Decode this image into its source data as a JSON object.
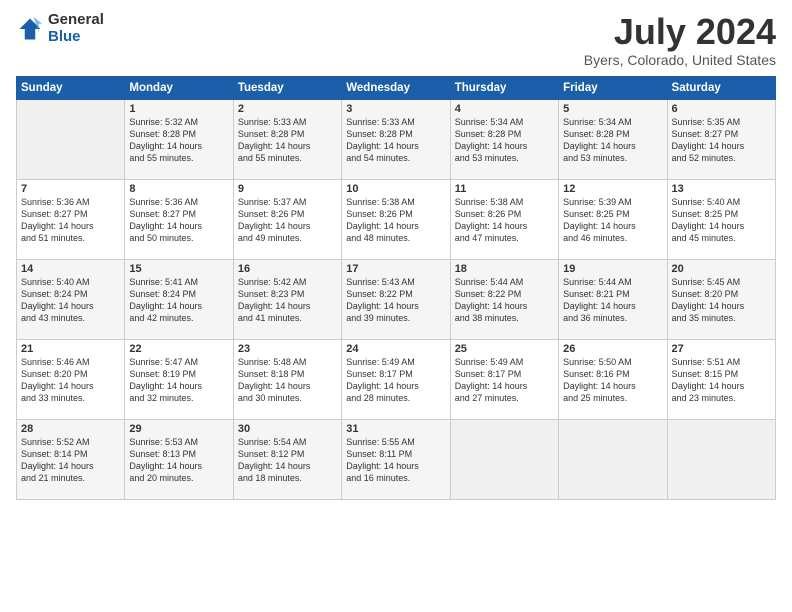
{
  "header": {
    "logo_general": "General",
    "logo_blue": "Blue",
    "month_year": "July 2024",
    "location": "Byers, Colorado, United States"
  },
  "columns": [
    "Sunday",
    "Monday",
    "Tuesday",
    "Wednesday",
    "Thursday",
    "Friday",
    "Saturday"
  ],
  "rows": [
    [
      {
        "day": "",
        "info": ""
      },
      {
        "day": "1",
        "info": "Sunrise: 5:32 AM\nSunset: 8:28 PM\nDaylight: 14 hours\nand 55 minutes."
      },
      {
        "day": "2",
        "info": "Sunrise: 5:33 AM\nSunset: 8:28 PM\nDaylight: 14 hours\nand 55 minutes."
      },
      {
        "day": "3",
        "info": "Sunrise: 5:33 AM\nSunset: 8:28 PM\nDaylight: 14 hours\nand 54 minutes."
      },
      {
        "day": "4",
        "info": "Sunrise: 5:34 AM\nSunset: 8:28 PM\nDaylight: 14 hours\nand 53 minutes."
      },
      {
        "day": "5",
        "info": "Sunrise: 5:34 AM\nSunset: 8:28 PM\nDaylight: 14 hours\nand 53 minutes."
      },
      {
        "day": "6",
        "info": "Sunrise: 5:35 AM\nSunset: 8:27 PM\nDaylight: 14 hours\nand 52 minutes."
      }
    ],
    [
      {
        "day": "7",
        "info": "Sunrise: 5:36 AM\nSunset: 8:27 PM\nDaylight: 14 hours\nand 51 minutes."
      },
      {
        "day": "8",
        "info": "Sunrise: 5:36 AM\nSunset: 8:27 PM\nDaylight: 14 hours\nand 50 minutes."
      },
      {
        "day": "9",
        "info": "Sunrise: 5:37 AM\nSunset: 8:26 PM\nDaylight: 14 hours\nand 49 minutes."
      },
      {
        "day": "10",
        "info": "Sunrise: 5:38 AM\nSunset: 8:26 PM\nDaylight: 14 hours\nand 48 minutes."
      },
      {
        "day": "11",
        "info": "Sunrise: 5:38 AM\nSunset: 8:26 PM\nDaylight: 14 hours\nand 47 minutes."
      },
      {
        "day": "12",
        "info": "Sunrise: 5:39 AM\nSunset: 8:25 PM\nDaylight: 14 hours\nand 46 minutes."
      },
      {
        "day": "13",
        "info": "Sunrise: 5:40 AM\nSunset: 8:25 PM\nDaylight: 14 hours\nand 45 minutes."
      }
    ],
    [
      {
        "day": "14",
        "info": "Sunrise: 5:40 AM\nSunset: 8:24 PM\nDaylight: 14 hours\nand 43 minutes."
      },
      {
        "day": "15",
        "info": "Sunrise: 5:41 AM\nSunset: 8:24 PM\nDaylight: 14 hours\nand 42 minutes."
      },
      {
        "day": "16",
        "info": "Sunrise: 5:42 AM\nSunset: 8:23 PM\nDaylight: 14 hours\nand 41 minutes."
      },
      {
        "day": "17",
        "info": "Sunrise: 5:43 AM\nSunset: 8:22 PM\nDaylight: 14 hours\nand 39 minutes."
      },
      {
        "day": "18",
        "info": "Sunrise: 5:44 AM\nSunset: 8:22 PM\nDaylight: 14 hours\nand 38 minutes."
      },
      {
        "day": "19",
        "info": "Sunrise: 5:44 AM\nSunset: 8:21 PM\nDaylight: 14 hours\nand 36 minutes."
      },
      {
        "day": "20",
        "info": "Sunrise: 5:45 AM\nSunset: 8:20 PM\nDaylight: 14 hours\nand 35 minutes."
      }
    ],
    [
      {
        "day": "21",
        "info": "Sunrise: 5:46 AM\nSunset: 8:20 PM\nDaylight: 14 hours\nand 33 minutes."
      },
      {
        "day": "22",
        "info": "Sunrise: 5:47 AM\nSunset: 8:19 PM\nDaylight: 14 hours\nand 32 minutes."
      },
      {
        "day": "23",
        "info": "Sunrise: 5:48 AM\nSunset: 8:18 PM\nDaylight: 14 hours\nand 30 minutes."
      },
      {
        "day": "24",
        "info": "Sunrise: 5:49 AM\nSunset: 8:17 PM\nDaylight: 14 hours\nand 28 minutes."
      },
      {
        "day": "25",
        "info": "Sunrise: 5:49 AM\nSunset: 8:17 PM\nDaylight: 14 hours\nand 27 minutes."
      },
      {
        "day": "26",
        "info": "Sunrise: 5:50 AM\nSunset: 8:16 PM\nDaylight: 14 hours\nand 25 minutes."
      },
      {
        "day": "27",
        "info": "Sunrise: 5:51 AM\nSunset: 8:15 PM\nDaylight: 14 hours\nand 23 minutes."
      }
    ],
    [
      {
        "day": "28",
        "info": "Sunrise: 5:52 AM\nSunset: 8:14 PM\nDaylight: 14 hours\nand 21 minutes."
      },
      {
        "day": "29",
        "info": "Sunrise: 5:53 AM\nSunset: 8:13 PM\nDaylight: 14 hours\nand 20 minutes."
      },
      {
        "day": "30",
        "info": "Sunrise: 5:54 AM\nSunset: 8:12 PM\nDaylight: 14 hours\nand 18 minutes."
      },
      {
        "day": "31",
        "info": "Sunrise: 5:55 AM\nSunset: 8:11 PM\nDaylight: 14 hours\nand 16 minutes."
      },
      {
        "day": "",
        "info": ""
      },
      {
        "day": "",
        "info": ""
      },
      {
        "day": "",
        "info": ""
      }
    ]
  ]
}
